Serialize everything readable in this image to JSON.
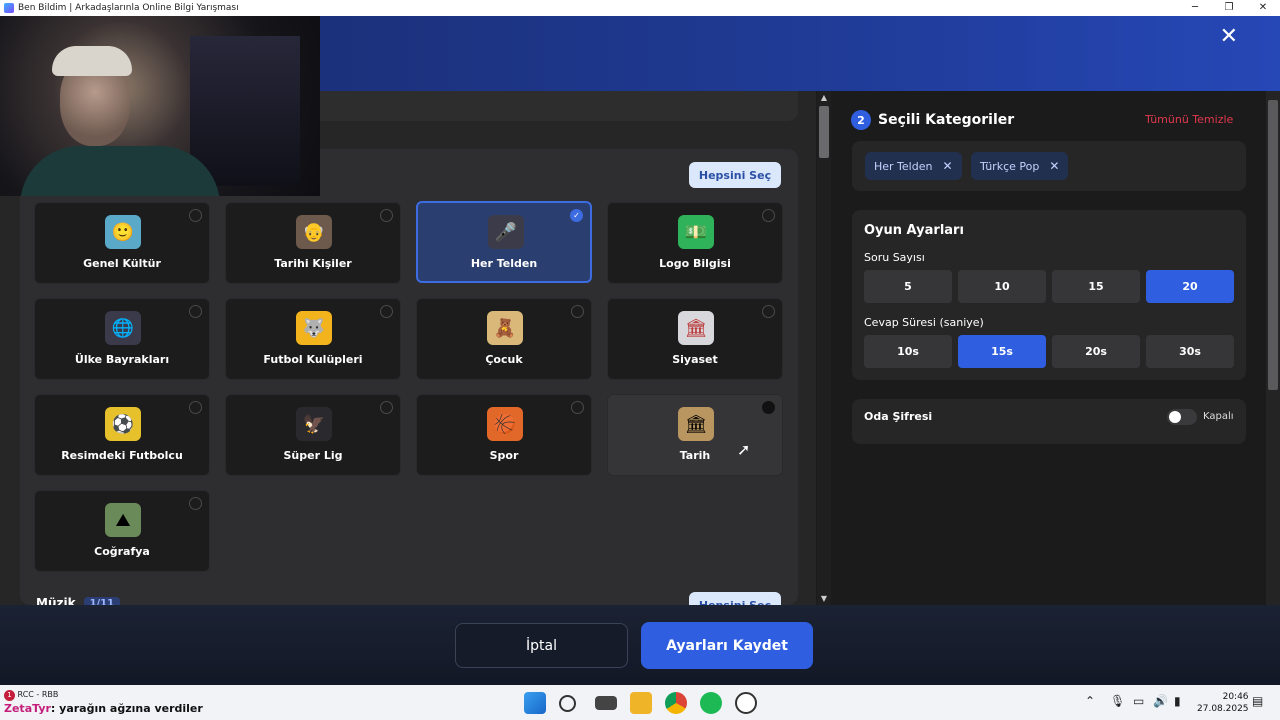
{
  "window": {
    "title": "Ben Bildim | Arkadaşlarınla Online Bilgi Yarışması",
    "minimize": "─",
    "maximize": "❐",
    "close": "✕"
  },
  "modal": {
    "close": "✕"
  },
  "categories": {
    "select_all": "Hepsini Seç",
    "items": [
      {
        "label": "Genel Kültür",
        "icon": "🙂",
        "selected": false
      },
      {
        "label": "Tarihi Kişiler",
        "icon": "👴",
        "selected": false
      },
      {
        "label": "Her Telden",
        "icon": "🎤",
        "selected": true
      },
      {
        "label": "Logo Bilgisi",
        "icon": "💵",
        "selected": false
      },
      {
        "label": "Ülke Bayrakları",
        "icon": "🌐",
        "selected": false
      },
      {
        "label": "Futbol Kulüpleri",
        "icon": "🐺",
        "selected": false
      },
      {
        "label": "Çocuk",
        "icon": "🧸",
        "selected": false
      },
      {
        "label": "Siyaset",
        "icon": "🏛",
        "selected": false
      },
      {
        "label": "Resimdeki Futbolcu",
        "icon": "⚽",
        "selected": false
      },
      {
        "label": "Süper Lig",
        "icon": "🦅",
        "selected": false
      },
      {
        "label": "Spor",
        "icon": "🏀",
        "selected": false
      },
      {
        "label": "Tarih",
        "icon": "🏛",
        "selected": false
      },
      {
        "label": "Coğrafya",
        "icon": "⛰",
        "selected": false
      }
    ],
    "selected_check": "✓"
  },
  "music": {
    "label": "Müzik",
    "count": "1/11",
    "select_all": "Hepsini Seç"
  },
  "selected_panel": {
    "number": "2",
    "title": "Seçili Kategoriler",
    "clear_all": "Tümünü Temizle",
    "chips": [
      "Her Telden",
      "Türkçe Pop"
    ],
    "chip_remove": "✕"
  },
  "settings": {
    "title": "Oyun Ayarları",
    "question_count_label": "Soru Sayısı",
    "question_counts": [
      "5",
      "10",
      "15",
      "20"
    ],
    "question_count_selected": "20",
    "answer_time_label": "Cevap Süresi (saniye)",
    "answer_times": [
      "10s",
      "15s",
      "20s",
      "30s"
    ],
    "answer_time_selected": "15s"
  },
  "password": {
    "label": "Oda Şifresi",
    "state": "Kapalı"
  },
  "footer": {
    "cancel": "İptal",
    "save": "Ayarları Kaydet"
  },
  "taskbar": {
    "notif_count": "1",
    "stream_line1": "RCC - RBB",
    "stream_user": "ZetaTyr",
    "stream_line2": ": yarağın ağzına verdiler",
    "time": "20:46",
    "date": "27.08.2025"
  }
}
